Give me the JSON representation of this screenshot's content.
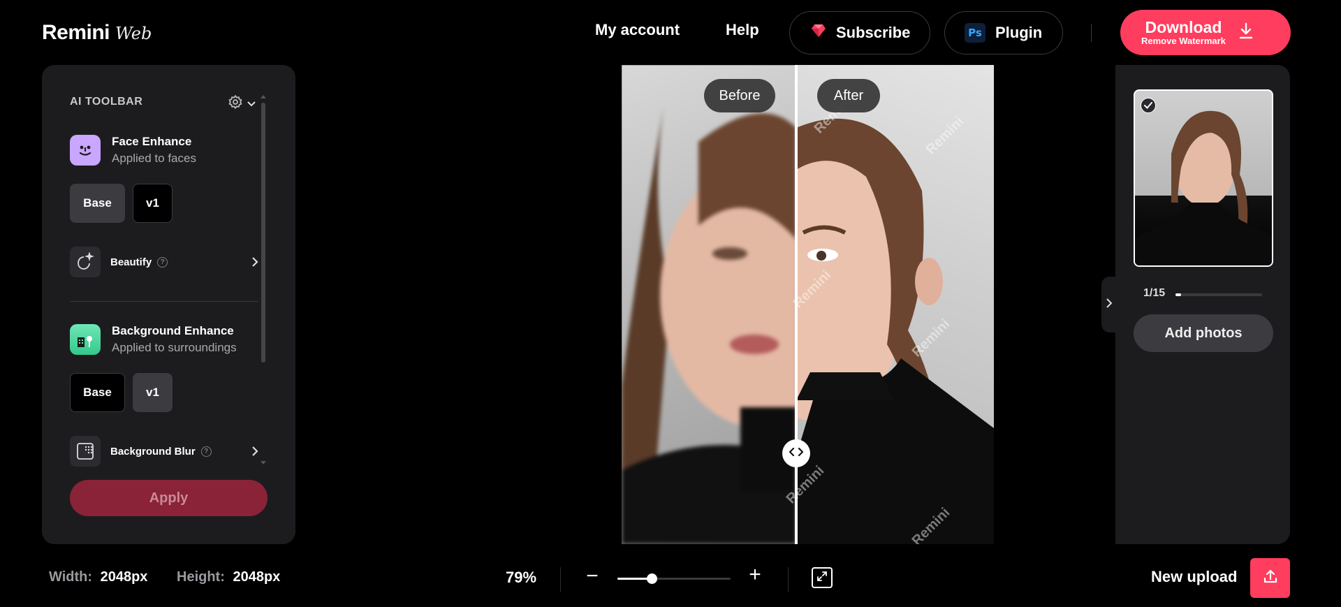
{
  "header": {
    "logo_main": "Remini",
    "logo_sub": "Web",
    "my_account": "My account",
    "help": "Help",
    "subscribe": "Subscribe",
    "plugin_badge": "Ps",
    "plugin": "Plugin",
    "download_main": "Download",
    "download_sub": "Remove Watermark"
  },
  "toolbar": {
    "title": "AI TOOLBAR",
    "face": {
      "title": "Face Enhance",
      "subtitle": "Applied to faces",
      "versions": [
        "Base",
        "v1"
      ],
      "selected": "Base"
    },
    "beautify": {
      "label": "Beautify",
      "info": "?"
    },
    "background": {
      "title": "Background Enhance",
      "subtitle": "Applied to surroundings",
      "versions": [
        "Base",
        "v1"
      ],
      "selected": "v1"
    },
    "blur": {
      "label": "Background Blur",
      "info": "?"
    },
    "apply": "Apply"
  },
  "viewer": {
    "before": "Before",
    "after": "After",
    "watermark": "Remini"
  },
  "right_panel": {
    "counter": "1/15",
    "progress": 0.067,
    "add_photos": "Add photos"
  },
  "footer": {
    "width_label": "Width:",
    "width_value": "2048px",
    "height_label": "Height:",
    "height_value": "2048px",
    "zoom": "79%",
    "zoom_fraction": 0.3,
    "zoom_minus": "−",
    "zoom_plus": "+",
    "new_upload": "New upload"
  },
  "colors": {
    "accent": "#ff3d5e",
    "panel": "#1c1c1f",
    "apply_disabled": "#8a2337"
  }
}
